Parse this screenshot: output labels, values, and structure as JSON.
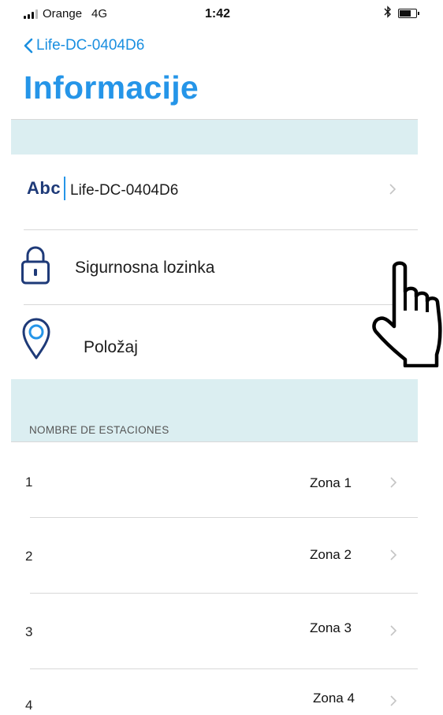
{
  "status_bar": {
    "carrier": "Orange",
    "network": "4G",
    "time": "1:42",
    "bluetooth_icon": "bluetooth-icon",
    "battery_icon": "battery-icon"
  },
  "nav": {
    "back_label": "Life-DC-0404D6",
    "title": "Informacije"
  },
  "settings": {
    "name": {
      "icon": "abc-text-icon",
      "icon_text": "Abc",
      "value": "Life-DC-0404D6"
    },
    "password": {
      "icon": "lock-icon",
      "label": "Sigurnosna lozinka"
    },
    "location": {
      "icon": "location-pin-icon",
      "label": "Položaj"
    }
  },
  "stations": {
    "header": "NOMBRE DE ESTACIONES",
    "rows": [
      {
        "number": "1",
        "zone": "Zona 1"
      },
      {
        "number": "2",
        "zone": "Zona 2"
      },
      {
        "number": "3",
        "zone": "Zona 3"
      },
      {
        "number": "4",
        "zone": "Zona 4"
      }
    ]
  },
  "overlay": {
    "icon": "pointing-hand-cursor-icon"
  },
  "colors": {
    "accent": "#2595e8",
    "band": "#dbeef1",
    "icon_navy": "#1e3a78"
  }
}
